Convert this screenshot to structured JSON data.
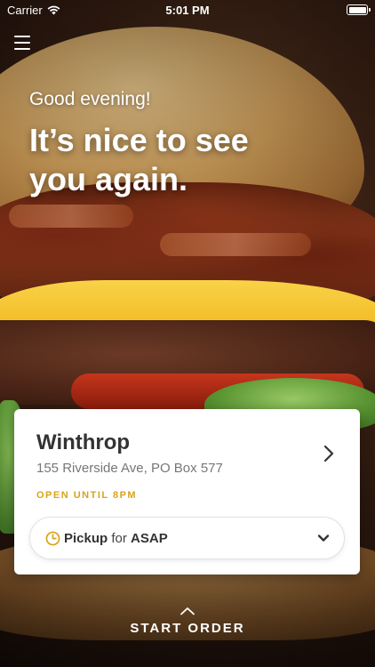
{
  "status_bar": {
    "carrier": "Carrier",
    "time": "5:01 PM"
  },
  "greeting": {
    "salutation": "Good evening!",
    "headline": "It’s nice to see you again."
  },
  "location": {
    "name": "Winthrop",
    "address": "155 Riverside Ave, PO Box 577",
    "hours_status": "OPEN UNTIL 8PM"
  },
  "order_mode": {
    "mode": "Pickup",
    "connector": "for",
    "time": "ASAP"
  },
  "start_order": {
    "label": "START ORDER"
  },
  "colors": {
    "accent": "#d9a31c",
    "card_background": "#ffffff"
  },
  "icons": {
    "menu": "hamburger-menu-icon",
    "location_chevron": "chevron-right-icon",
    "pickup_clock": "clock-icon",
    "dropdown": "chevron-down-icon",
    "start_chevron": "chevron-up-icon",
    "wifi": "wifi-icon",
    "battery": "battery-icon"
  }
}
